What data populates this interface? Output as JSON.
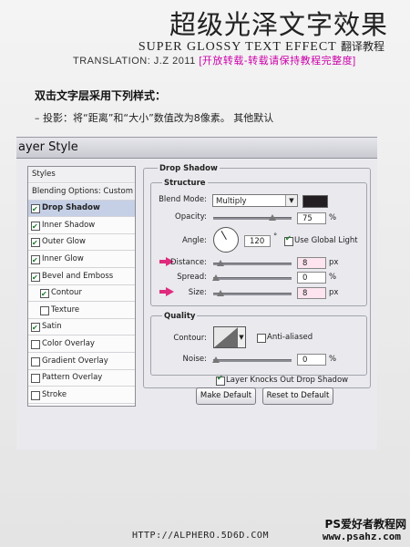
{
  "header": {
    "title_cn": "超级光泽文字效果",
    "title_en": "SUPER GLOSSY TEXT EFFECT",
    "title_en_cn": "翻译教程",
    "credit": "TRANSLATION: J.Z   2011",
    "credit_note": "[开放转载-转载请保持教程完整度]"
  },
  "instructions": {
    "line1": "双击文字层采用下列样式：",
    "line2": "– 投影：将“距离”和“大小”数值改为8像素。 其他默认"
  },
  "dialog": {
    "title": "ayer Style",
    "styles_list": [
      {
        "label": "Styles",
        "type": "header"
      },
      {
        "label": "Blending Options: Custom",
        "type": "header"
      },
      {
        "label": "Drop Shadow",
        "checked": true,
        "selected": true
      },
      {
        "label": "Inner Shadow",
        "checked": true
      },
      {
        "label": "Outer Glow",
        "checked": true
      },
      {
        "label": "Inner Glow",
        "checked": true
      },
      {
        "label": "Bevel and Emboss",
        "checked": true
      },
      {
        "label": "Contour",
        "checked": true,
        "indent": true
      },
      {
        "label": "Texture",
        "checked": false,
        "indent": true
      },
      {
        "label": "Satin",
        "checked": true
      },
      {
        "label": "Color Overlay",
        "checked": false
      },
      {
        "label": "Gradient Overlay",
        "checked": false
      },
      {
        "label": "Pattern Overlay",
        "checked": false
      },
      {
        "label": "Stroke",
        "checked": false
      }
    ],
    "panel_title": "Drop Shadow",
    "structure": {
      "group_label": "Structure",
      "blend_mode_label": "Blend Mode:",
      "blend_mode_value": "Multiply",
      "shadow_color": "#231e22",
      "opacity_label": "Opacity:",
      "opacity_value": "75",
      "opacity_unit": "%",
      "opacity_fraction": 0.75,
      "angle_label": "Angle:",
      "angle_value": "120",
      "angle_unit": "°",
      "use_global_light_label": "Use Global Light",
      "use_global_light": true,
      "distance_label": "Distance:",
      "distance_value": "8",
      "distance_unit": "px",
      "spread_label": "Spread:",
      "spread_value": "0",
      "spread_unit": "%",
      "size_label": "Size:",
      "size_value": "8",
      "size_unit": "px"
    },
    "quality": {
      "group_label": "Quality",
      "contour_label": "Contour:",
      "anti_aliased_label": "Anti-aliased",
      "anti_aliased": false,
      "noise_label": "Noise:",
      "noise_value": "0",
      "noise_unit": "%"
    },
    "knockout_label": "Layer Knocks Out Drop Shadow",
    "knockout": true,
    "make_default_label": "Make Default",
    "reset_default_label": "Reset to Default"
  },
  "footer": {
    "url": "HTTP://ALPHERO.5D6D.COM",
    "site_cn": "PS爱好者教程网",
    "site_url": "www.psahz.com"
  },
  "colors": {
    "accent_pink": "#e02a7d",
    "credit_note": "#cc00aa",
    "selected_row": "#c5d0e6"
  }
}
